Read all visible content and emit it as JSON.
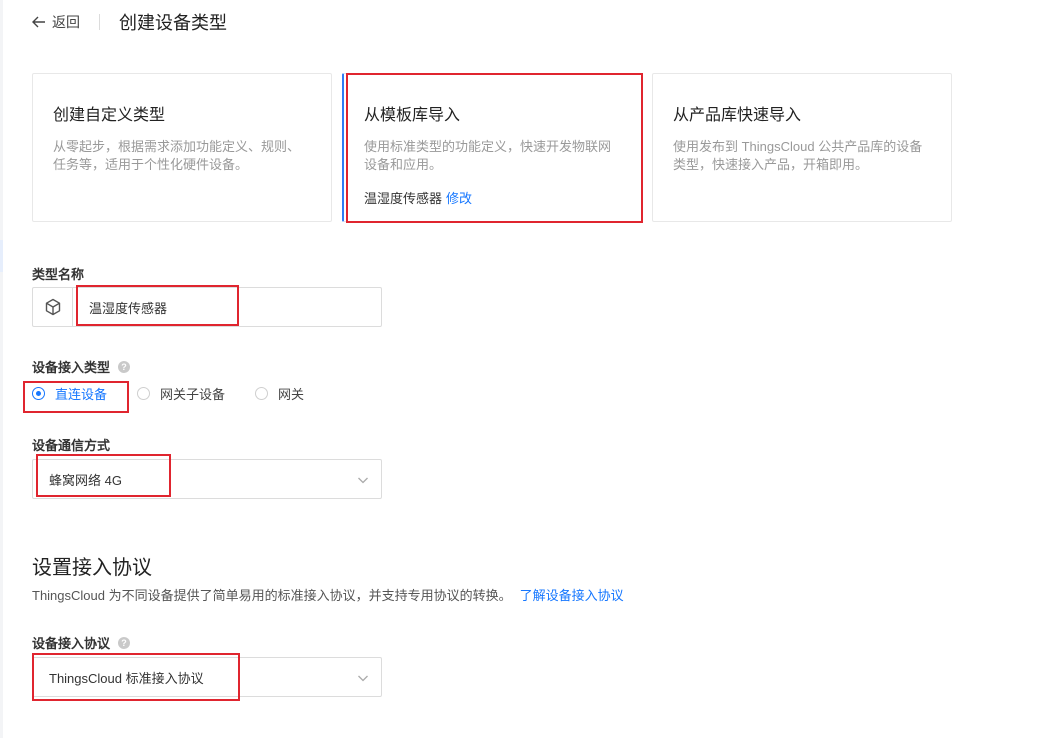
{
  "header": {
    "back_label": "返回",
    "title": "创建设备类型"
  },
  "cards": [
    {
      "title": "创建自定义类型",
      "desc": "从零起步，根据需求添加功能定义、规则、任务等，适用于个性化硬件设备。"
    },
    {
      "title": "从模板库导入",
      "desc": "使用标准类型的功能定义，快速开发物联网设备和应用。",
      "selected_template": "温湿度传感器",
      "modify_link": "修改"
    },
    {
      "title": "从产品库快速导入",
      "desc": "使用发布到 ThingsCloud 公共产品库的设备类型，快速接入产品，开箱即用。"
    }
  ],
  "form": {
    "type_name_label": "类型名称",
    "type_name_value": "温湿度传感器",
    "access_type_label": "设备接入类型",
    "access_type_options": [
      "直连设备",
      "网关子设备",
      "网关"
    ],
    "access_type_selected": "直连设备",
    "comm_label": "设备通信方式",
    "comm_value": "蜂窝网络 4G"
  },
  "protocol_section": {
    "title": "设置接入协议",
    "desc": "ThingsCloud 为不同设备提供了简单易用的标准接入协议，并支持专用协议的转换。",
    "learn_link": "了解设备接入协议",
    "protocol_label": "设备接入协议",
    "protocol_value": "ThingsCloud 标准接入协议"
  },
  "colors": {
    "accent": "#1677ff",
    "highlight": "#e0252f"
  },
  "icons": {
    "back": "arrow-left-icon",
    "cube": "cube-icon",
    "chevron": "chevron-down-icon",
    "help": "question-circle-icon"
  }
}
